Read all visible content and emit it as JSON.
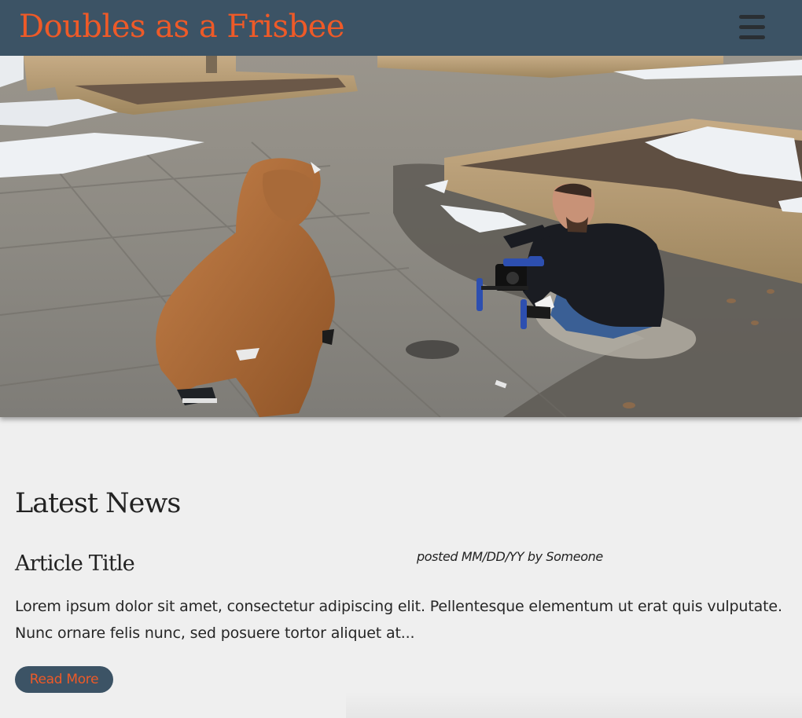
{
  "header": {
    "site_title": "Doubles as a Frisbee",
    "menu_icon": "hamburger-menu-icon"
  },
  "colors": {
    "header_bg": "#3c5365",
    "accent": "#ee5a28",
    "page_bg": "#efefef"
  },
  "main": {
    "section_heading": "Latest News",
    "article": {
      "title": "Article Title",
      "meta": "posted MM/DD/YY by Someone",
      "excerpt": "Lorem ipsum dolor sit amet, consectetur adipiscing elit. Pellentesque elementum ut erat quis vulputate. Nunc ornare felis nunc, sed posuere tortor aliquet at...",
      "read_more_label": "Read More"
    }
  }
}
